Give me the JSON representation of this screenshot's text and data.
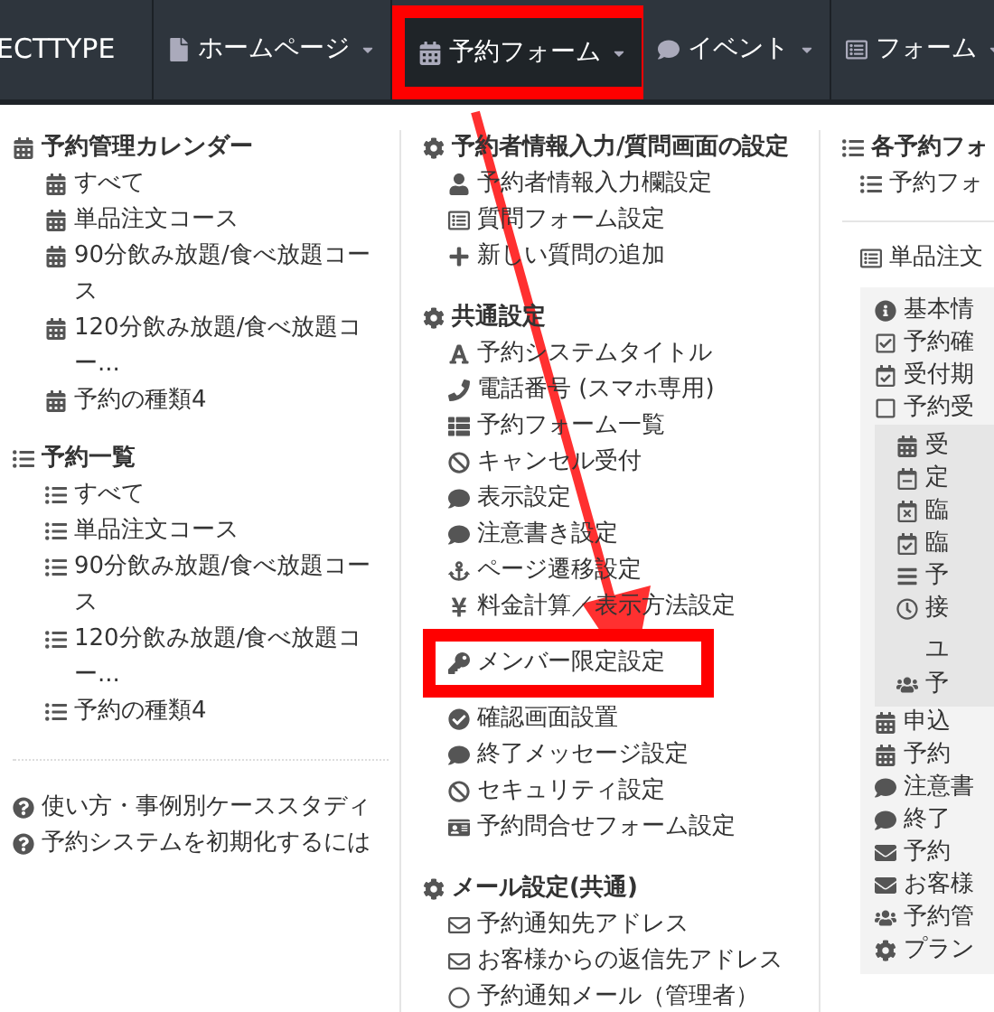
{
  "navbar": {
    "brand": "ECTTYPE",
    "items": [
      {
        "label": "ホームページ",
        "selected": false,
        "highlighted": false
      },
      {
        "label": "予約フォーム",
        "selected": true,
        "highlighted": true
      },
      {
        "label": "イベント",
        "selected": false,
        "highlighted": false
      },
      {
        "label": "フォーム",
        "selected": false,
        "highlighted": false
      }
    ]
  },
  "left_column": {
    "sections": [
      {
        "title": "予約管理カレンダー",
        "items": [
          "すべて",
          "単品注文コース",
          "90分飲み放題/食べ放題コース",
          "120分飲み放題/食べ放題コー...",
          "予約の種類4"
        ]
      },
      {
        "title": "予約一覧",
        "items": [
          "すべて",
          "単品注文コース",
          "90分飲み放題/食べ放題コース",
          "120分飲み放題/食べ放題コー...",
          "予約の種類4"
        ]
      }
    ],
    "help_links": [
      "使い方・事例別ケーススタディ",
      "予約システムを初期化するには"
    ]
  },
  "middle_column": {
    "sections": [
      {
        "title": "予約者情報入力/質問画面の設定",
        "items": [
          {
            "label": "予約者情報入力欄設定",
            "highlighted": false
          },
          {
            "label": "質問フォーム設定",
            "highlighted": false
          },
          {
            "label": "新しい質問の追加",
            "highlighted": false
          }
        ]
      },
      {
        "title": "共通設定",
        "items": [
          {
            "label": "予約システムタイトル",
            "highlighted": false
          },
          {
            "label": "電話番号 (スマホ専用)",
            "highlighted": false
          },
          {
            "label": "予約フォーム一覧",
            "highlighted": false
          },
          {
            "label": "キャンセル受付",
            "highlighted": false
          },
          {
            "label": "表示設定",
            "highlighted": false
          },
          {
            "label": "注意書き設定",
            "highlighted": false
          },
          {
            "label": "ページ遷移設定",
            "highlighted": false
          },
          {
            "label": "料金計算／表示方法設定",
            "highlighted": false
          },
          {
            "label": "メンバー限定設定",
            "highlighted": true
          },
          {
            "label": "確認画面設置",
            "highlighted": false
          },
          {
            "label": "終了メッセージ設定",
            "highlighted": false
          },
          {
            "label": "セキュリティ設定",
            "highlighted": false
          },
          {
            "label": "予約問合せフォーム設定",
            "highlighted": false
          }
        ]
      },
      {
        "title": "メール設定(共通)",
        "items": [
          {
            "label": "予約通知先アドレス",
            "highlighted": false
          },
          {
            "label": "お客様からの返信先アドレス",
            "highlighted": false
          },
          {
            "label": "予約通知メール（管理者）",
            "highlighted": false
          }
        ]
      }
    ]
  },
  "right_column": {
    "title": "各予約フォ",
    "title_items": [
      "予約フォ"
    ],
    "form_title": "単品注文",
    "panel_items": [
      "基本情",
      "予約確",
      "受付期",
      "予約受"
    ],
    "subpanel_items": [
      {
        "label": "受"
      },
      {
        "label": "定"
      },
      {
        "label": "臨"
      },
      {
        "label": "臨"
      },
      {
        "label": "予"
      },
      {
        "label": "接",
        "label_line_2": "ユ"
      },
      {
        "label": "予"
      }
    ],
    "after_items": [
      "申込",
      "予約",
      "注意書",
      "終了",
      "予約",
      "お客様",
      "予約管",
      "プラン"
    ]
  }
}
